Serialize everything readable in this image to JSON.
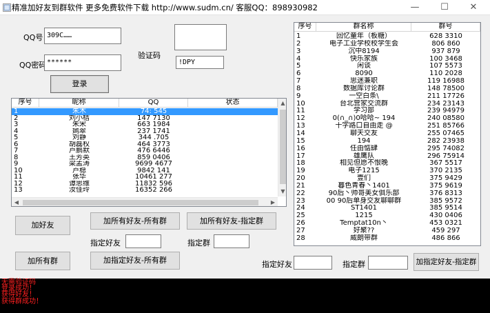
{
  "window": {
    "title": "精准加好友到群软件 更多免费软件下载 http://www.sudm.cn/ 客服QQ：898930982",
    "min_glyph": "—",
    "max_glyph": "☐",
    "close_glyph": "✕"
  },
  "login": {
    "qq_label": "QQ号",
    "qq_value": "309C……",
    "pwd_label": "QQ密码",
    "pwd_value": "******",
    "captcha_label": "验证码",
    "captcha_value": "!DPY",
    "login_button": "登录"
  },
  "friends": {
    "headers": [
      "序号",
      "昵称",
      "QQ",
      "状态"
    ],
    "rows": [
      [
        "1",
        "朱木",
        "74:  545",
        ""
      ],
      [
        "2",
        "刘小桔",
        "147  7130",
        ""
      ],
      [
        "3",
        "朱宋",
        "663  1984",
        ""
      ],
      [
        "4",
        "嫣翠",
        "237  1741",
        ""
      ],
      [
        "5",
        "刘静",
        "344  .705",
        ""
      ],
      [
        "6",
        "胡磊权",
        "464   3773",
        ""
      ],
      [
        "7",
        "卢鹏默",
        "476   6446",
        ""
      ],
      [
        "8",
        "王芳英",
        "859   0406",
        ""
      ],
      [
        "9",
        "梁孟涛",
        "9699  4677",
        ""
      ],
      [
        "10",
        "卢稳",
        "9842   141",
        ""
      ],
      [
        "11",
        "张华",
        "10461  277",
        ""
      ],
      [
        "12",
        "谭思维",
        "11832  596",
        ""
      ],
      [
        "13",
        "汝佳玲",
        "16352  266",
        ""
      ]
    ],
    "selected_row": 0
  },
  "groups": {
    "headers": [
      "序号",
      "群名称",
      "群号"
    ],
    "rows": [
      [
        "1",
        "回忆童年（板糖）",
        "628  3310"
      ],
      [
        "2",
        "电子工业学校校学生会",
        "806  860"
      ],
      [
        "3",
        "沉中8194",
        "937  879"
      ],
      [
        "4",
        "快乐家族",
        "100  3468"
      ],
      [
        "5",
        "闲谈",
        "107  5573"
      ],
      [
        "6",
        "8090",
        "110  2028"
      ],
      [
        "7",
        "思迷兼职",
        "119  16988"
      ],
      [
        "8",
        "数据库讨论群",
        "148  78500"
      ],
      [
        "9",
        "一空白条\\",
        "211  17726"
      ],
      [
        "10",
        "台北营家交流群",
        "234  23143"
      ],
      [
        "11",
        "学习部",
        "239  94979"
      ],
      [
        "12",
        "0(∩_∩)0哈哈~ 194",
        "240  08580"
      ],
      [
        "13",
        "十字路口自由走 @",
        "251  85766"
      ],
      [
        "14",
        "聊天交友",
        "255  07465"
      ],
      [
        "15",
        "194",
        "282  23938"
      ],
      [
        "16",
        "任由惦肆",
        "295  74082"
      ],
      [
        "17",
        "雄鹰队",
        "296  75914"
      ],
      [
        "18",
        "相见但愿不恨晚",
        "367  5517"
      ],
      [
        "19",
        "电子1215",
        "370  2135"
      ],
      [
        "20",
        "壹们",
        "375  9429"
      ],
      [
        "21",
        "暮色青春丶1401",
        "375  9619"
      ],
      [
        "22",
        "90后丶帅哥美女俱乐部",
        "376  8313"
      ],
      [
        "23",
        "00  90后单身交友聊聊群",
        "385  9572"
      ],
      [
        "24",
        "ST1401",
        "385  9514"
      ],
      [
        "25",
        "1215",
        "430  0406"
      ],
      [
        "26",
        "Temptat10n丶",
        "453  0321"
      ],
      [
        "27",
        "好聚??",
        "459  297"
      ],
      [
        "28",
        "威朗带群",
        "486  866"
      ]
    ]
  },
  "actions": {
    "add_friend": "加好友",
    "add_all_groups": "加所有好友-所有群",
    "add_to_group": "加所有好友-指定群",
    "specify_friend_label": "指定好友",
    "specify_group_label": "指定群",
    "join_all_groups": "加所有群",
    "specified_friend_all_groups": "加指定好友-所有群",
    "bottom_specify_friend_label": "指定好友",
    "bottom_specify_group_label": "指定群",
    "specified_friend_specified_group": "加指定好友-指定群"
  },
  "log": {
    "lines": [
      "无需验证码",
      "登录成功！",
      "获得好友！",
      "获得群成功！"
    ]
  },
  "colors": {
    "selection": "#3399ff",
    "log_text": "#ff2020",
    "log_bg": "#000000"
  }
}
